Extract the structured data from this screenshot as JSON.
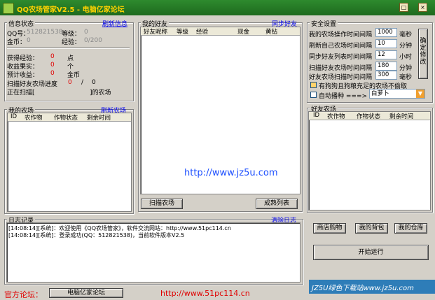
{
  "window": {
    "title": "QQ农场管家V2.5 - 电脑亿家论坛",
    "btn_min": "□",
    "btn_close": "×"
  },
  "info": {
    "group": "信息状态",
    "refresh": "刷新信息",
    "qq_label": "QQ号：",
    "qq_value": "512821538",
    "level_label": "等级：",
    "level_value": "0",
    "gold_label": "金币：",
    "gold_value": "0",
    "exp_label": "经验：",
    "exp_value": "0/200",
    "gain_exp_label": "获得经验：",
    "gain_exp_value": "0",
    "gain_exp_unit": "点",
    "harvest_label": "收益果实：",
    "harvest_value": "0",
    "harvest_unit": "个",
    "est_label": "预计收益：",
    "est_value": "0",
    "est_unit": "金币",
    "scan_label": "扫描好友农场进度",
    "scan_cur": "0",
    "scan_sep": "/",
    "scan_total": "0",
    "scanning_label": "正在扫描[",
    "scanning_suffix": "]的农场"
  },
  "my_farm": {
    "group": "我的农场",
    "refresh": "刷新农场",
    "cols": [
      "ID",
      "农作物",
      "作物状态",
      "剩余时间"
    ]
  },
  "friends": {
    "group": "我的好友",
    "sync": "同步好友",
    "cols": [
      "好友昵称",
      "等级",
      "经验",
      "现金",
      "黄钻"
    ],
    "btn_scan": "扫描农场",
    "btn_ripe": "成熟列表"
  },
  "security": {
    "group": "安全设置",
    "rows": [
      {
        "label": "我的农场操作时间间隔",
        "value": "1000",
        "unit": "毫秒"
      },
      {
        "label": "刷新自己农场时间间隔",
        "value": "10",
        "unit": "分钟"
      },
      {
        "label": "同步好友列表时间间隔",
        "value": "12",
        "unit": "小时"
      },
      {
        "label": "扫描好友农场时间间隔",
        "value": "180",
        "unit": "分钟"
      },
      {
        "label": "好友农场扫描时间间隔",
        "value": "300",
        "unit": "毫秒"
      }
    ],
    "confirm_btn": "确定修改",
    "dog_label": "有狗狗且狗粮充足的农场不偷取",
    "auto_sow_label": "自动播种 ===>",
    "seed_select": "白萝卜"
  },
  "friend_farm": {
    "group": "好友农场",
    "cols": [
      "ID",
      "农作物",
      "作物状态",
      "剩余时间"
    ]
  },
  "log": {
    "group": "日志记录",
    "clear": "清除日志",
    "lines": [
      "[14:08:14][系统]：欢迎使用《QQ农场管家》，软件交流网站：http://www.51pc114.cn",
      "[14:08:14][系统]：登录成功(QQ：512821538)，当前软件版本V2.5"
    ]
  },
  "actions": {
    "shop": "商店购物",
    "bag": "我的背包",
    "warehouse": "我的仓库",
    "start": "开始运行"
  },
  "watermarks": {
    "center": "http://www.jz5u.com",
    "bottom_right": "JZ5U绿色下载站www.jz5u.com"
  },
  "bottom": {
    "forum_label": "官方论坛：",
    "forum_btn": "电脑亿家论坛",
    "url": "http://www.51pc114.cn"
  },
  "colors": {
    "title_bg": "#2e8a2e",
    "title_text": "#ffd200",
    "link": "#0000ee",
    "red": "#e00000"
  }
}
